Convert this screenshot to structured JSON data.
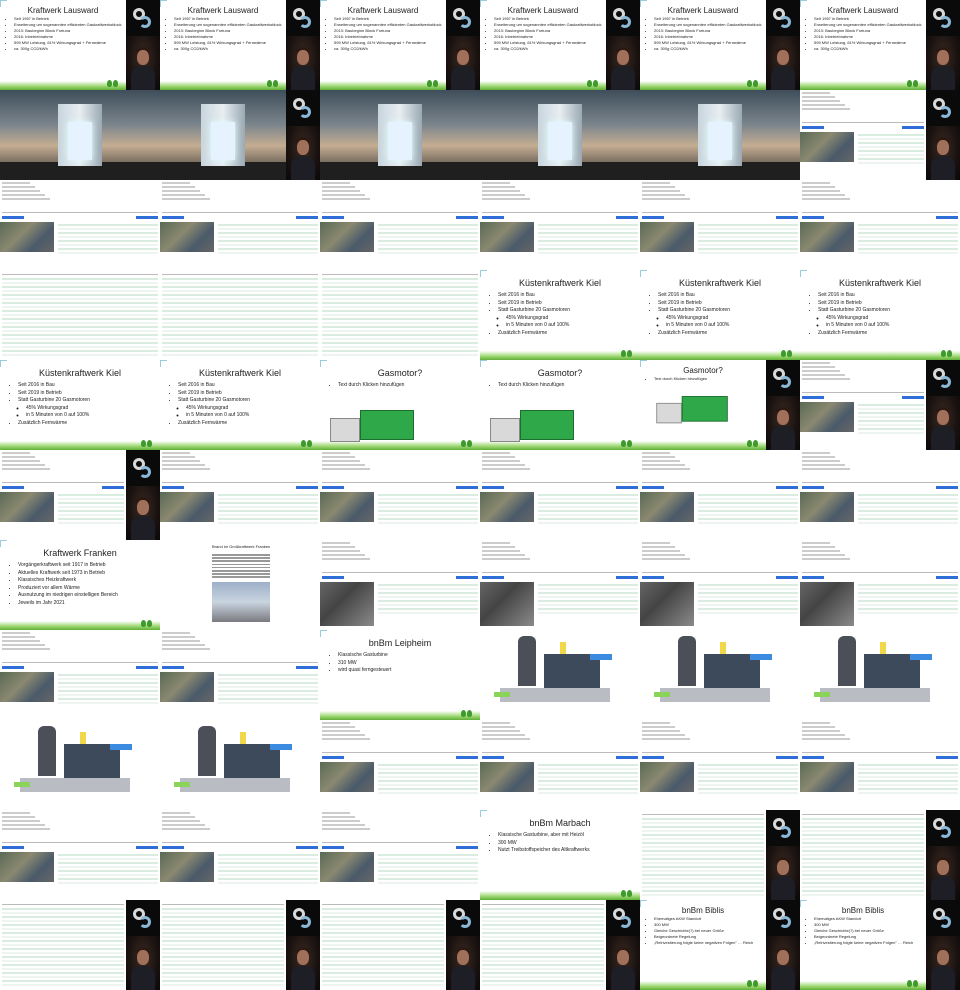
{
  "grid": {
    "columns": 6,
    "rows": 11
  },
  "colors": {
    "accent_blue": "#2f6ed8",
    "grass": "#6cc04a",
    "table_green": "#d9ece0",
    "logo_blue": "#8ab8d8"
  },
  "slides": {
    "lausward": {
      "title": "Kraftwerk Lausward",
      "bullets": [
        "Seit 1957 in Betrieb",
        "Erweiterung um sogenannten effizienten Gaskraftwerksblock",
        "2013: Baubeginn Block Fortuna",
        "2016: Inbetriebnahme",
        "595 MW Leistung, 61% Wirkungsgrad + Fernwärme",
        "ca. 300g CO2/kWh"
      ]
    },
    "kiel": {
      "title": "Küstenkraftwerk Kiel",
      "bullets": [
        {
          "text": "Seit 2016 in Bau",
          "sub": false
        },
        {
          "text": "Seit 2019 in Betrieb",
          "sub": false
        },
        {
          "text": "Statt Gasturbine 20 Gasmotoren",
          "sub": false
        },
        {
          "text": "45% Wirkungsgrad",
          "sub": true
        },
        {
          "text": "in 5 Minuten von 0 auf 100%",
          "sub": true
        },
        {
          "text": "Zusätzlich Fernwärme",
          "sub": false
        }
      ]
    },
    "gasmotor": {
      "title": "Gasmotor?",
      "bullets": [
        "Text durch Klicken hinzufügen"
      ]
    },
    "franken": {
      "title": "Kraftwerk Franken",
      "bullets": [
        "Vorgängerkraftwerk seit 1917 in Betrieb",
        "Aktuelles Kraftwerk seit 1973 in Betrieb",
        "Klassisches Heizkraftwerk",
        "Produziert vor allem Wärme",
        "Ausnutzung im niedrigen einstelligen Bereich",
        "Jeweils im Jahr 2021"
      ]
    },
    "article": {
      "title": "Brand im Großkraftwerk Franken"
    },
    "leipheim": {
      "title": "bnBm Leipheim",
      "bullets": [
        "Klassische Gasturbine",
        "310 MW",
        "wird quasi ferngesteuert"
      ]
    },
    "marbach": {
      "title": "bnBm Marbach",
      "bullets": [
        "Klassische Gasturbine, aber mit Heizöl",
        "300 MW",
        "Nutzt Treibstoffspeicher des Altkraftwerks"
      ]
    },
    "biblis": {
      "title": "bnBm Biblis",
      "bullets": [
        "Ehemaliges AKW Standort",
        "300 MW",
        "Gleiche Geschichte(?) bei neuer Größe",
        "Beigeordnete Regelung",
        "„Reinvestierung folgte keine negativen Folgen\" … Reich"
      ]
    }
  },
  "tiles": [
    "lausward-cam",
    "lausward-cam",
    "lausward-cam",
    "lausward-cam",
    "lausward-cam",
    "lausward-cam",
    "photo",
    "photo-cam",
    "photo",
    "photo",
    "photo",
    "sheet-cam",
    "sheet",
    "sheet",
    "sheet",
    "sheet",
    "sheet",
    "sheet",
    "table",
    "table",
    "table",
    "kiel-wide",
    "kiel-wide",
    "kiel-wide",
    "kiel-wide",
    "kiel-wide",
    "gasmotor",
    "gasmotor",
    "gasmotor-small-cam",
    "sheet-cam",
    "sheet-cam",
    "sheet",
    "sheet",
    "sheet",
    "sheet",
    "sheet",
    "franken",
    "article",
    "sheet-turbine",
    "sheet-turbine",
    "sheet-turbine",
    "sheet-turbine",
    "sheet",
    "sheet",
    "leipheim",
    "turbine",
    "turbine",
    "turbine",
    "turbine",
    "turbine",
    "sheet",
    "sheet",
    "sheet",
    "sheet",
    "sheet",
    "sheet",
    "sheet",
    "marbach",
    "table-cam",
    "table-cam",
    "table-cam",
    "table-cam",
    "table-cam",
    "table-cam",
    "biblis-cam",
    "biblis-cam"
  ]
}
